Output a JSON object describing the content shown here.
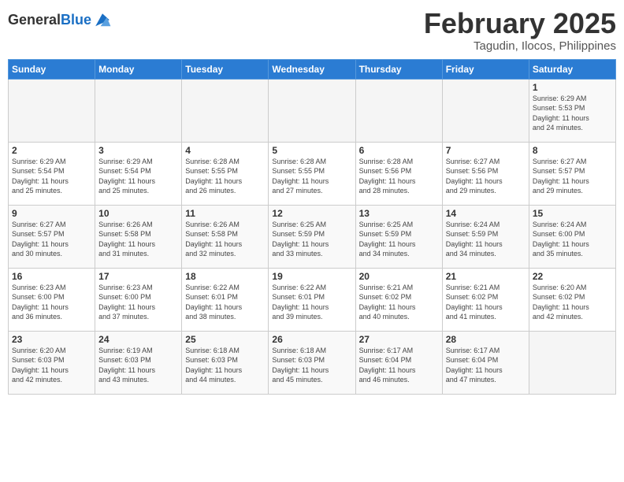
{
  "header": {
    "logo_general": "General",
    "logo_blue": "Blue",
    "month_title": "February 2025",
    "subtitle": "Tagudin, Ilocos, Philippines"
  },
  "weekdays": [
    "Sunday",
    "Monday",
    "Tuesday",
    "Wednesday",
    "Thursday",
    "Friday",
    "Saturday"
  ],
  "weeks": [
    [
      {
        "day": "",
        "info": ""
      },
      {
        "day": "",
        "info": ""
      },
      {
        "day": "",
        "info": ""
      },
      {
        "day": "",
        "info": ""
      },
      {
        "day": "",
        "info": ""
      },
      {
        "day": "",
        "info": ""
      },
      {
        "day": "1",
        "info": "Sunrise: 6:29 AM\nSunset: 5:53 PM\nDaylight: 11 hours\nand 24 minutes."
      }
    ],
    [
      {
        "day": "2",
        "info": "Sunrise: 6:29 AM\nSunset: 5:54 PM\nDaylight: 11 hours\nand 25 minutes."
      },
      {
        "day": "3",
        "info": "Sunrise: 6:29 AM\nSunset: 5:54 PM\nDaylight: 11 hours\nand 25 minutes."
      },
      {
        "day": "4",
        "info": "Sunrise: 6:28 AM\nSunset: 5:55 PM\nDaylight: 11 hours\nand 26 minutes."
      },
      {
        "day": "5",
        "info": "Sunrise: 6:28 AM\nSunset: 5:55 PM\nDaylight: 11 hours\nand 27 minutes."
      },
      {
        "day": "6",
        "info": "Sunrise: 6:28 AM\nSunset: 5:56 PM\nDaylight: 11 hours\nand 28 minutes."
      },
      {
        "day": "7",
        "info": "Sunrise: 6:27 AM\nSunset: 5:56 PM\nDaylight: 11 hours\nand 29 minutes."
      },
      {
        "day": "8",
        "info": "Sunrise: 6:27 AM\nSunset: 5:57 PM\nDaylight: 11 hours\nand 29 minutes."
      }
    ],
    [
      {
        "day": "9",
        "info": "Sunrise: 6:27 AM\nSunset: 5:57 PM\nDaylight: 11 hours\nand 30 minutes."
      },
      {
        "day": "10",
        "info": "Sunrise: 6:26 AM\nSunset: 5:58 PM\nDaylight: 11 hours\nand 31 minutes."
      },
      {
        "day": "11",
        "info": "Sunrise: 6:26 AM\nSunset: 5:58 PM\nDaylight: 11 hours\nand 32 minutes."
      },
      {
        "day": "12",
        "info": "Sunrise: 6:25 AM\nSunset: 5:59 PM\nDaylight: 11 hours\nand 33 minutes."
      },
      {
        "day": "13",
        "info": "Sunrise: 6:25 AM\nSunset: 5:59 PM\nDaylight: 11 hours\nand 34 minutes."
      },
      {
        "day": "14",
        "info": "Sunrise: 6:24 AM\nSunset: 5:59 PM\nDaylight: 11 hours\nand 34 minutes."
      },
      {
        "day": "15",
        "info": "Sunrise: 6:24 AM\nSunset: 6:00 PM\nDaylight: 11 hours\nand 35 minutes."
      }
    ],
    [
      {
        "day": "16",
        "info": "Sunrise: 6:23 AM\nSunset: 6:00 PM\nDaylight: 11 hours\nand 36 minutes."
      },
      {
        "day": "17",
        "info": "Sunrise: 6:23 AM\nSunset: 6:00 PM\nDaylight: 11 hours\nand 37 minutes."
      },
      {
        "day": "18",
        "info": "Sunrise: 6:22 AM\nSunset: 6:01 PM\nDaylight: 11 hours\nand 38 minutes."
      },
      {
        "day": "19",
        "info": "Sunrise: 6:22 AM\nSunset: 6:01 PM\nDaylight: 11 hours\nand 39 minutes."
      },
      {
        "day": "20",
        "info": "Sunrise: 6:21 AM\nSunset: 6:02 PM\nDaylight: 11 hours\nand 40 minutes."
      },
      {
        "day": "21",
        "info": "Sunrise: 6:21 AM\nSunset: 6:02 PM\nDaylight: 11 hours\nand 41 minutes."
      },
      {
        "day": "22",
        "info": "Sunrise: 6:20 AM\nSunset: 6:02 PM\nDaylight: 11 hours\nand 42 minutes."
      }
    ],
    [
      {
        "day": "23",
        "info": "Sunrise: 6:20 AM\nSunset: 6:03 PM\nDaylight: 11 hours\nand 42 minutes."
      },
      {
        "day": "24",
        "info": "Sunrise: 6:19 AM\nSunset: 6:03 PM\nDaylight: 11 hours\nand 43 minutes."
      },
      {
        "day": "25",
        "info": "Sunrise: 6:18 AM\nSunset: 6:03 PM\nDaylight: 11 hours\nand 44 minutes."
      },
      {
        "day": "26",
        "info": "Sunrise: 6:18 AM\nSunset: 6:03 PM\nDaylight: 11 hours\nand 45 minutes."
      },
      {
        "day": "27",
        "info": "Sunrise: 6:17 AM\nSunset: 6:04 PM\nDaylight: 11 hours\nand 46 minutes."
      },
      {
        "day": "28",
        "info": "Sunrise: 6:17 AM\nSunset: 6:04 PM\nDaylight: 11 hours\nand 47 minutes."
      },
      {
        "day": "",
        "info": ""
      }
    ]
  ]
}
